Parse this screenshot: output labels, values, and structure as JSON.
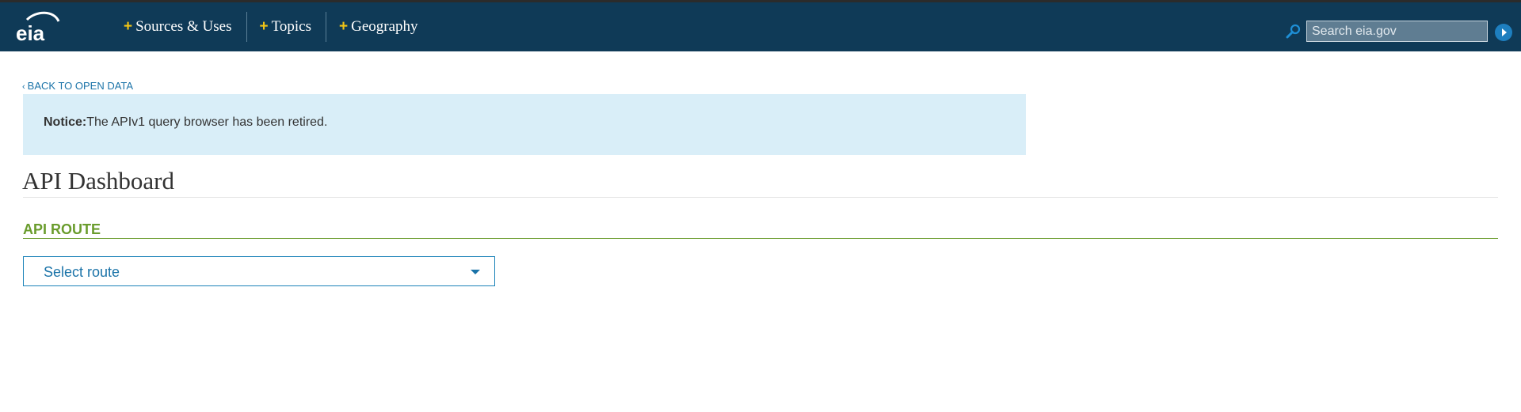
{
  "header": {
    "logo_text": "eia",
    "nav": [
      {
        "label": "Sources & Uses"
      },
      {
        "label": "Topics"
      },
      {
        "label": "Geography"
      }
    ],
    "nav_prefix": "+",
    "search": {
      "placeholder": "Search eia.gov",
      "value": ""
    }
  },
  "back_link": {
    "label": "BACK TO OPEN DATA"
  },
  "notice": {
    "label": "Notice:",
    "text": "The APIv1 query browser has been retired."
  },
  "page": {
    "title": "API Dashboard"
  },
  "api_route": {
    "heading": "API ROUTE",
    "select_value": "Select route"
  },
  "colors": {
    "header_bg": "#0f3a57",
    "nav_plus": "#f2c515",
    "link": "#1a73a8",
    "notice_bg": "#d9eef8",
    "section_green": "#6a9c2d"
  },
  "icons": {
    "logo": "eia-logo-icon",
    "search": "search-icon",
    "search_go": "search-go-icon",
    "back": "chevron-left-icon",
    "dropdown": "caret-down-icon"
  }
}
